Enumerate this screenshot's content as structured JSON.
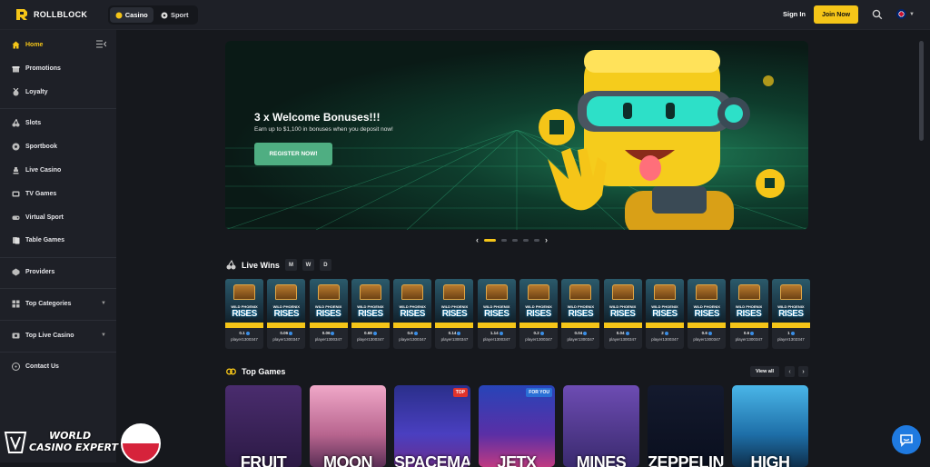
{
  "brand": {
    "name": "ROLLBLOCK",
    "accent": "#f5c518",
    "secondary": "#4fae82"
  },
  "topbar": {
    "tabs": [
      {
        "label": "Casino",
        "active": true
      },
      {
        "label": "Sport",
        "active": false
      }
    ],
    "signin_label": "Sign In",
    "join_label": "Join Now"
  },
  "sidebar": {
    "items": [
      {
        "label": "Home",
        "icon": "home-icon"
      },
      {
        "label": "Promotions",
        "icon": "gift-icon"
      },
      {
        "label": "Loyalty",
        "icon": "medal-icon"
      },
      {
        "label": "Slots",
        "icon": "cherry-icon"
      },
      {
        "label": "Sportbook",
        "icon": "ball-icon"
      },
      {
        "label": "Live Casino",
        "icon": "chess-icon"
      },
      {
        "label": "TV Games",
        "icon": "tv-icon"
      },
      {
        "label": "Virtual Sport",
        "icon": "gamepad-icon"
      },
      {
        "label": "Table Games",
        "icon": "cards-icon"
      },
      {
        "label": "Providers",
        "icon": "provider-icon"
      },
      {
        "label": "Top Categories",
        "icon": "grid-icon"
      },
      {
        "label": "Top Live Casino",
        "icon": "live-icon"
      },
      {
        "label": "Contact Us",
        "icon": "chat-icon"
      }
    ]
  },
  "banner": {
    "title": "3 x Welcome Bonuses!!!",
    "subtitle": "Earn up to $1,100 in bonuses when you deposit now!",
    "cta": "REGISTER NOW!",
    "slide_count": 5,
    "active_slide": 1
  },
  "live_wins": {
    "title": "Live Wins",
    "filters": [
      "M",
      "W",
      "D"
    ],
    "game_label_top": "WILD PHOENIX",
    "game_label": "RISES",
    "items": [
      {
        "amount": "0.1",
        "user": "player1300347"
      },
      {
        "amount": "0.06",
        "user": "player1300347"
      },
      {
        "amount": "0.06",
        "user": "player1300347"
      },
      {
        "amount": "0.68",
        "user": "player1300347"
      },
      {
        "amount": "0.6",
        "user": "player1300347"
      },
      {
        "amount": "0.14",
        "user": "player1300347"
      },
      {
        "amount": "1.14",
        "user": "player1300347"
      },
      {
        "amount": "0.2",
        "user": "player1300347"
      },
      {
        "amount": "0.04",
        "user": "player1300347"
      },
      {
        "amount": "0.04",
        "user": "player1300347"
      },
      {
        "amount": "2",
        "user": "player1300347"
      },
      {
        "amount": "0.6",
        "user": "player1300347"
      },
      {
        "amount": "0.6",
        "user": "player1300347"
      },
      {
        "amount": "1",
        "user": "player1302347"
      }
    ]
  },
  "top_games": {
    "title": "Top Games",
    "view_all": "View all",
    "games": [
      {
        "title": "FRUIT",
        "tag": "",
        "bg": "linear-gradient(#4a2c6e,#2c1a45)"
      },
      {
        "title": "MOON",
        "tag": "",
        "bg": "linear-gradient(#f0a8c8,#b8658f 60%,#5a2e55)"
      },
      {
        "title": "SPACEMAN",
        "tag": "TOP",
        "tag_color": "#e0332d",
        "bg": "linear-gradient(#2a2f8a,#4a3fc0 60%,#6a2d8e)"
      },
      {
        "title": "JETX",
        "tag": "FOR YOU",
        "tag_color": "#2a6fd6",
        "bg": "linear-gradient(#2744b8,#5a2fa6 60%,#c03a82)"
      },
      {
        "title": "MINES",
        "tag": "",
        "bg": "linear-gradient(#6d4cb3,#3a2a6e)"
      },
      {
        "title": "ZEPPELIN",
        "tag": "",
        "bg": "linear-gradient(#141a2e,#0a0f1e)"
      },
      {
        "title": "HIGH",
        "tag": "",
        "bg": "linear-gradient(#4ab6e8,#1e6fa8 60%,#0e2e4a)"
      }
    ]
  },
  "watermark": {
    "line1": "WORLD",
    "line2": "CASINO EXPERT"
  }
}
